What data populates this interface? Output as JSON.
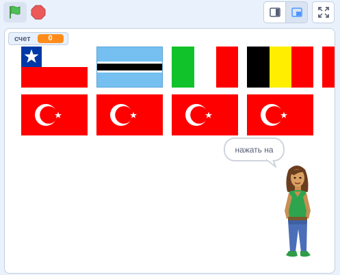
{
  "toolbar": {
    "green_flag_icon": "green-flag-icon",
    "stop_icon": "stop-sign-icon",
    "small_stage_icon": "small-stage-layout-icon",
    "normal_stage_icon": "normal-stage-layout-icon",
    "fullscreen_icon": "fullscreen-icon"
  },
  "monitor": {
    "label": "счет",
    "value": "0"
  },
  "sprites": {
    "row1": [
      "Chile",
      "Botswana",
      "Italy",
      "Belgium",
      "Turkey"
    ],
    "row2": [
      "Turkey",
      "Turkey",
      "Turkey",
      "Turkey"
    ]
  },
  "speech": {
    "text": "нажать на"
  },
  "colors": {
    "green_flag": "#4cbf56",
    "stop": "#ec5959",
    "monitor_value_bg": "#ff8c1a",
    "accent_blue": "#4c97ff"
  }
}
